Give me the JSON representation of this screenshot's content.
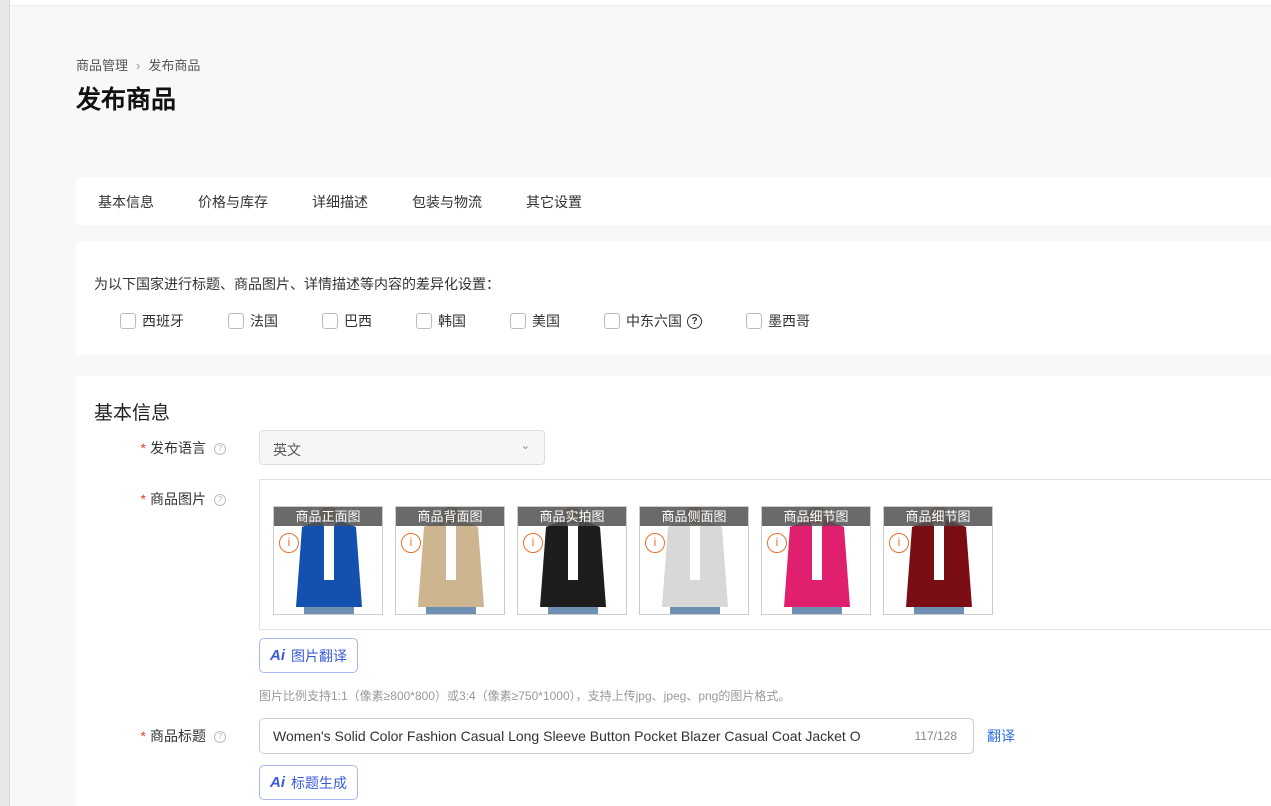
{
  "breadcrumb": {
    "parent": "商品管理",
    "sep": "›",
    "current": "发布商品"
  },
  "page_title": "发布商品",
  "tabs": [
    "基本信息",
    "价格与库存",
    "详细描述",
    "包装与物流",
    "其它设置"
  ],
  "countries": {
    "label": "为以下国家进行标题、商品图片、详情描述等内容的差异化设置：",
    "items": [
      "西班牙",
      "法国",
      "巴西",
      "韩国",
      "美国",
      "中东六国",
      "墨西哥"
    ],
    "help_icon": "?"
  },
  "basic": {
    "section_title": "基本信息",
    "language": {
      "label": "发布语言",
      "value": "英文"
    },
    "images": {
      "label": "商品图片",
      "thumbs": [
        {
          "caption": "商品正面图",
          "color": "#1450b0"
        },
        {
          "caption": "商品背面图",
          "color": "#cdb590"
        },
        {
          "caption": "商品实拍图",
          "color": "#1d1d1d"
        },
        {
          "caption": "商品侧面图",
          "color": "#d8d8d8"
        },
        {
          "caption": "商品细节图",
          "color": "#e0206e"
        },
        {
          "caption": "商品细节图",
          "color": "#7a0e14"
        }
      ],
      "translate_button": "图片翻译",
      "ai_label": "Ai",
      "note": "图片比例支持1:1（像素≥800*800）或3:4（像素≥750*1000），支持上传jpg、jpeg、png的图片格式。"
    },
    "title": {
      "label": "商品标题",
      "value": "Women's Solid Color Fashion Casual Long Sleeve Button Pocket Blazer Casual Coat Jacket O",
      "count": "117/128",
      "translate_link": "翻译",
      "generate_button": "标题生成"
    }
  }
}
